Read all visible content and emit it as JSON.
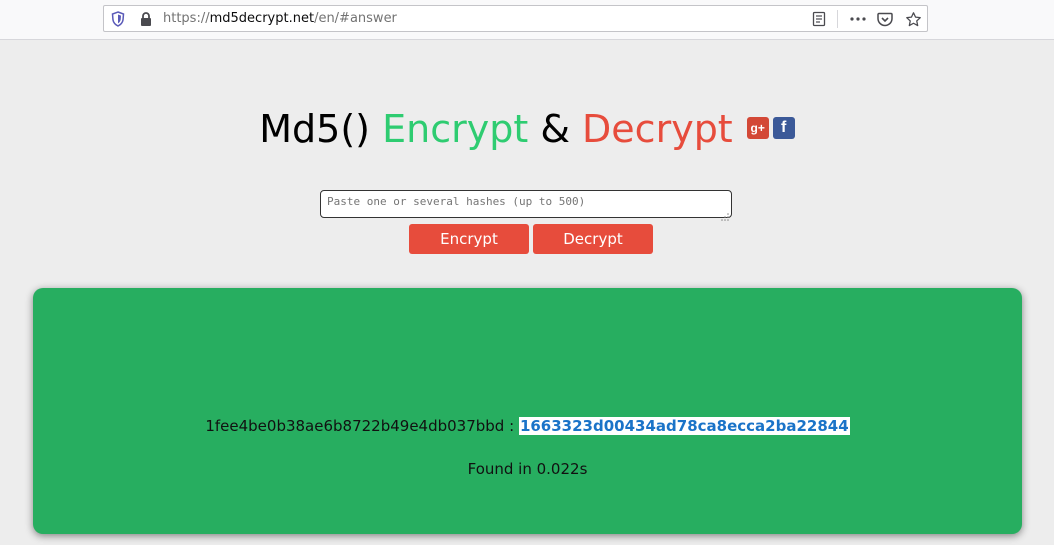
{
  "browser": {
    "url_prefix": "https://",
    "url_domain": "md5decrypt.net",
    "url_path": "/en/#answer",
    "icons": [
      "shield-icon",
      "lock-icon",
      "reader-view-icon",
      "more-actions-icon",
      "pocket-icon",
      "bookmark-star-icon"
    ]
  },
  "header": {
    "title_md5": "Md5()",
    "title_encrypt": "Encrypt",
    "title_amp": "&",
    "title_decrypt": "Decrypt",
    "gplus_label": "g+",
    "facebook_label": "f"
  },
  "form": {
    "hash_placeholder": "Paste one or several hashes (up to 500)",
    "encrypt_label": "Encrypt",
    "decrypt_label": "Decrypt"
  },
  "result": {
    "hash": "1fee4be0b38ae6b8722b49e4db037bbd",
    "separator": " : ",
    "answer": "1663323d00434ad78ca8ecca2ba22844",
    "found_text": "Found in 0.022s"
  },
  "colors": {
    "encrypt_green": "#2ecc71",
    "decrypt_red": "#e74c3c",
    "result_green": "#27ae60",
    "answer_blue": "#1a73c8"
  }
}
